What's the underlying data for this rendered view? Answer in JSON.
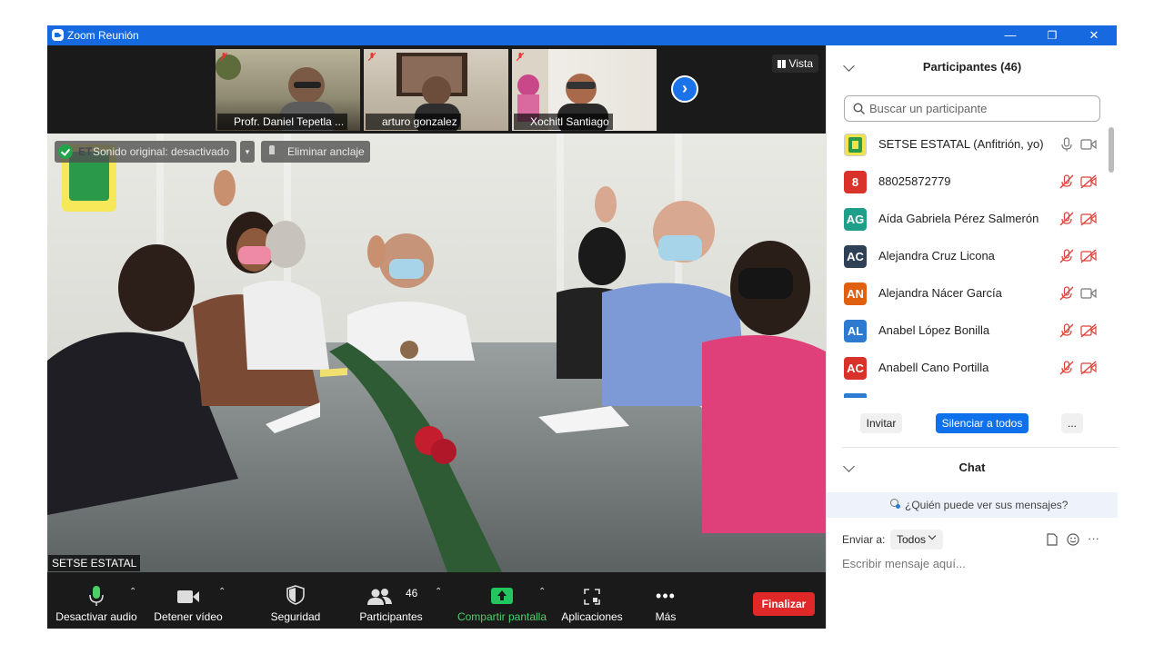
{
  "window": {
    "title": "Zoom Reunión",
    "minimize": "—",
    "restore": "❐",
    "close": "✕"
  },
  "strip": {
    "thumbs": [
      {
        "name": "Profr. Daniel Tepetla ..."
      },
      {
        "name": "arturo gonzalez"
      },
      {
        "name": "Xochitl Santiago"
      }
    ],
    "vista_label": "Vista",
    "next_arrow": "›"
  },
  "main_video": {
    "sound_chip": "Sonido original: desactivado",
    "unpin_chip": "Eliminar anclaje",
    "self_name": "SETSE ESTATAL",
    "logo_text": "ET"
  },
  "toolbar": {
    "audio": "Desactivar audio",
    "video": "Detener vídeo",
    "security": "Seguridad",
    "participants": "Participantes",
    "participants_count": "46",
    "share": "Compartir pantalla",
    "apps": "Aplicaciones",
    "more": "Más",
    "end": "Finalizar"
  },
  "panel": {
    "participants_title": "Participantes (46)",
    "search_placeholder": "Buscar un participante",
    "participants": [
      {
        "initials": "",
        "name": "SETSE ESTATAL (Anfitrión, yo)",
        "color": "#ffffff",
        "muted": false,
        "video_off": false
      },
      {
        "initials": "8",
        "name": "88025872779",
        "color": "#d9322b",
        "muted": true,
        "video_off": true
      },
      {
        "initials": "AG",
        "name": "Aída Gabriela Pérez Salmerón",
        "color": "#1f9e89",
        "muted": true,
        "video_off": true
      },
      {
        "initials": "AC",
        "name": "Alejandra Cruz Licona",
        "color": "#2f4156",
        "muted": true,
        "video_off": true
      },
      {
        "initials": "AN",
        "name": "Alejandra Nácer García",
        "color": "#e06010",
        "muted": true,
        "video_off": false
      },
      {
        "initials": "AL",
        "name": "Anabel López Bonilla",
        "color": "#2d7bd1",
        "muted": true,
        "video_off": true
      },
      {
        "initials": "AC",
        "name": "Anabell Cano Portilla",
        "color": "#d9322b",
        "muted": true,
        "video_off": true
      }
    ],
    "invite": "Invitar",
    "mute_all": "Silenciar a todos",
    "more": "...",
    "chat_title": "Chat",
    "who_sees": "¿Quién puede ver sus mensajes?",
    "send_to_label": "Enviar a:",
    "send_to_value": "Todos",
    "message_placeholder": "Escribir mensaje aquí...",
    "more_dots": "···"
  },
  "colors": {
    "accent": "#1769e0",
    "end": "#e02828",
    "share": "#22c55e",
    "button_blue": "#0e71eb"
  }
}
